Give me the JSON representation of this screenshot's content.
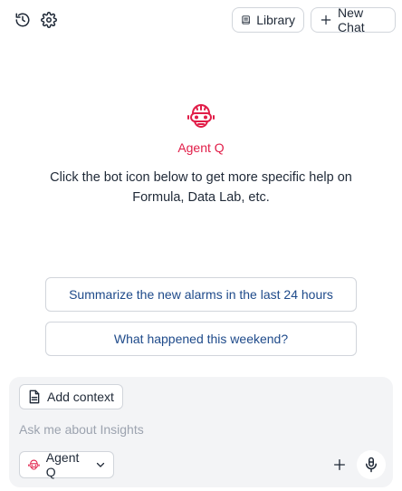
{
  "toolbar": {
    "history_icon": "history-icon",
    "settings_icon": "gear-icon",
    "library_label": "Library",
    "new_chat_label": "New Chat"
  },
  "hero": {
    "agent_name": "Agent Q",
    "description": "Click the bot icon below to get more specific help on Formula, Data Lab, etc."
  },
  "suggestions": [
    "Summarize the new alarms in the last 24 hours",
    "What happened this weekend?"
  ],
  "composer": {
    "add_context_label": "Add context",
    "placeholder": "Ask me about Insights",
    "agent_select_value": "Agent Q"
  },
  "colors": {
    "accent": "#e11d48",
    "suggestion_text": "#1e4a8a",
    "composer_bg": "#f3f4f6"
  }
}
